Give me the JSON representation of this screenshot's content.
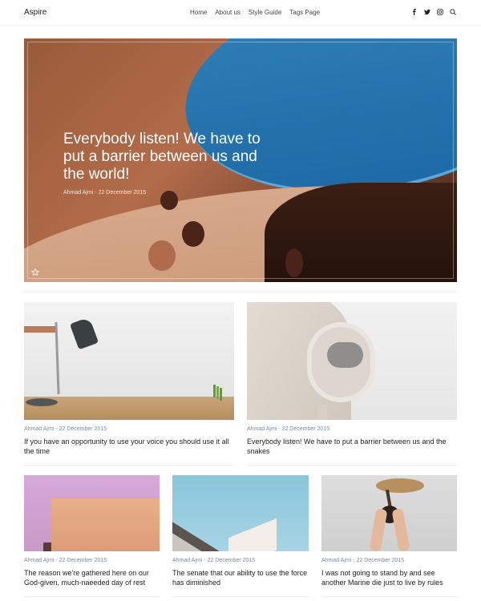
{
  "header": {
    "logo": "Aspire",
    "nav": [
      "Home",
      "About us",
      "Style Guide",
      "Tags Page"
    ],
    "icons": [
      "facebook-icon",
      "twitter-icon",
      "instagram-icon",
      "search-icon"
    ]
  },
  "hero": {
    "title": "Everybody listen! We have to put a barrier between us and the world!",
    "meta": "Ahmad Ajmi - 22 December 2015"
  },
  "posts": [
    {
      "meta": "Ahmad Ajmi - 22 December 2015",
      "title": "If you have an opportunity to use your voice you should use it all the time"
    },
    {
      "meta": "Ahmad Ajmi - 22 December 2015",
      "title": "Everybody listen! We have to put a barrier between us and the snakes"
    },
    {
      "meta": "Ahmad Ajmi - 22 December 2015",
      "title": "The reason we're gathered here on our God-given, much-naeeded day of rest"
    },
    {
      "meta": "Ahmad Ajmi - 22 December 2015",
      "title": "The senate that our ability to use the force has diminished"
    },
    {
      "meta": "Ahmad Ajmi - 22 December 2015",
      "title": "I was not going to stand by and see another Marine die just to live by rules"
    }
  ]
}
